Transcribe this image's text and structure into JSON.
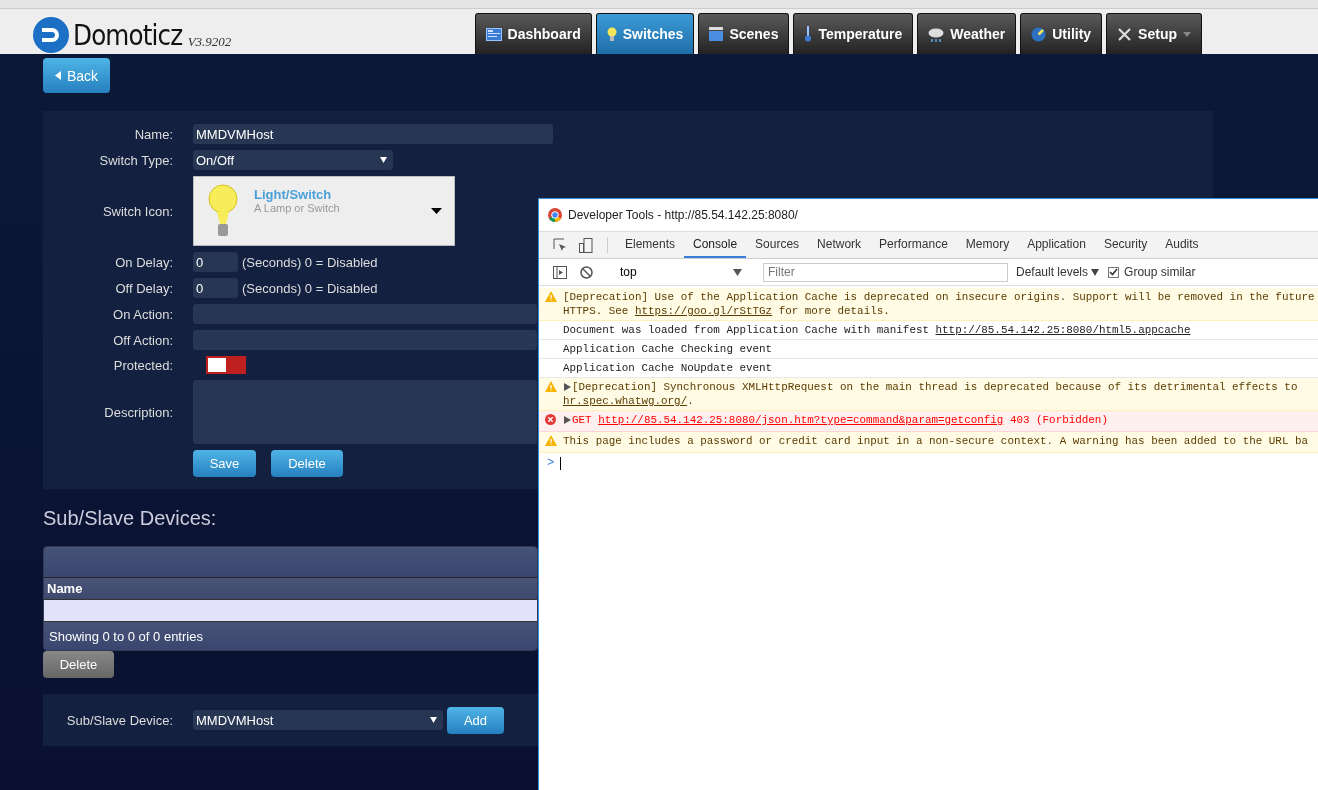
{
  "header": {
    "logo_text": "Domoticz",
    "version": "V3.9202",
    "nav": [
      {
        "label": "Dashboard",
        "selected": false
      },
      {
        "label": "Switches",
        "selected": true
      },
      {
        "label": "Scenes",
        "selected": false
      },
      {
        "label": "Temperature",
        "selected": false
      },
      {
        "label": "Weather",
        "selected": false
      },
      {
        "label": "Utility",
        "selected": false
      },
      {
        "label": "Setup",
        "selected": false,
        "has_menu": true
      }
    ]
  },
  "back_button": "Back",
  "form": {
    "rows": [
      {
        "kind": "text",
        "label": "Name:",
        "value": "MMDVMHost"
      },
      {
        "kind": "select",
        "label": "Switch Type:",
        "value": "On/Off"
      },
      {
        "kind": "icon",
        "label": "Switch Icon:",
        "title": "Light/Switch",
        "subtitle": "A Lamp or Switch"
      },
      {
        "kind": "delay",
        "label": "On Delay:",
        "value": "0",
        "hint": "(Seconds) 0 = Disabled"
      },
      {
        "kind": "delay",
        "label": "Off Delay:",
        "value": "0",
        "hint": "(Seconds) 0 = Disabled"
      },
      {
        "kind": "wide",
        "label": "On Action:"
      },
      {
        "kind": "wide",
        "label": "Off Action:"
      },
      {
        "kind": "toggle",
        "label": "Protected:",
        "on": false
      },
      {
        "kind": "textarea",
        "label": "Description:"
      }
    ],
    "buttons": [
      "Save",
      "Delete"
    ]
  },
  "sub_devices": {
    "heading": "Sub/Slave Devices:",
    "table": {
      "columns": [
        "Name"
      ],
      "footer": "Showing 0 to 0 of 0 entries"
    },
    "delete_button": {
      "label": "Delete",
      "disabled": true
    },
    "add_row": {
      "label": "Sub/Slave Device:",
      "value": "MMDVMHost",
      "button": "Add"
    }
  },
  "devtools": {
    "title": "Developer Tools - http://85.54.142.25:8080/",
    "tabs": [
      {
        "label": "Elements",
        "selected": false
      },
      {
        "label": "Console",
        "selected": true
      },
      {
        "label": "Sources",
        "selected": false
      },
      {
        "label": "Network",
        "selected": false
      },
      {
        "label": "Performance",
        "selected": false
      },
      {
        "label": "Memory",
        "selected": false
      },
      {
        "label": "Application",
        "selected": false
      },
      {
        "label": "Security",
        "selected": false
      },
      {
        "label": "Audits",
        "selected": false
      }
    ],
    "context": "top",
    "filter_placeholder": "Filter",
    "levels": "Default levels",
    "group_similar": {
      "label": "Group similar",
      "checked": true
    },
    "messages": [
      {
        "kind": "warning",
        "has_details": false,
        "lines": [
          [
            {
              "kind": "text",
              "text": "[Deprecation] Use of the Application Cache is deprecated on insecure origins. Support will be removed in the future"
            }
          ],
          [
            {
              "kind": "text",
              "text": "HTTPS. See "
            },
            {
              "kind": "link",
              "text": "https://goo.gl/rStTGz"
            },
            {
              "kind": "text",
              "text": " for more details."
            }
          ]
        ]
      },
      {
        "kind": "info",
        "has_details": false,
        "lines": [
          [
            {
              "kind": "text",
              "text": "Document was loaded from Application Cache with manifest "
            },
            {
              "kind": "link",
              "text": "http://85.54.142.25:8080/html5.appcache"
            }
          ]
        ]
      },
      {
        "kind": "info",
        "has_details": false,
        "lines": [
          [
            {
              "kind": "text",
              "text": "Application Cache Checking event"
            }
          ]
        ]
      },
      {
        "kind": "info",
        "has_details": false,
        "lines": [
          [
            {
              "kind": "text",
              "text": "Application Cache NoUpdate event"
            }
          ]
        ]
      },
      {
        "kind": "warning",
        "has_details": true,
        "lines": [
          [
            {
              "kind": "text",
              "text": "[Deprecation] Synchronous XMLHttpRequest on the main thread is deprecated because of its detrimental effects to"
            }
          ],
          [
            {
              "kind": "link",
              "text": "hr.spec.whatwg.org/"
            },
            {
              "kind": "text",
              "text": "."
            }
          ]
        ]
      },
      {
        "kind": "error",
        "has_details": true,
        "lines": [
          [
            {
              "kind": "text",
              "text": "GET "
            },
            {
              "kind": "link",
              "text": "http://85.54.142.25:8080/json.htm?type=command&param=getconfig"
            },
            {
              "kind": "text",
              "text": " 403 (Forbidden)"
            }
          ]
        ]
      },
      {
        "kind": "warning",
        "has_details": false,
        "lines": [
          [
            {
              "kind": "text",
              "text": "This page includes a password or credit card input in a non-secure context. A warning has been added to the URL ba"
            }
          ]
        ]
      }
    ],
    "prompt": ">"
  }
}
